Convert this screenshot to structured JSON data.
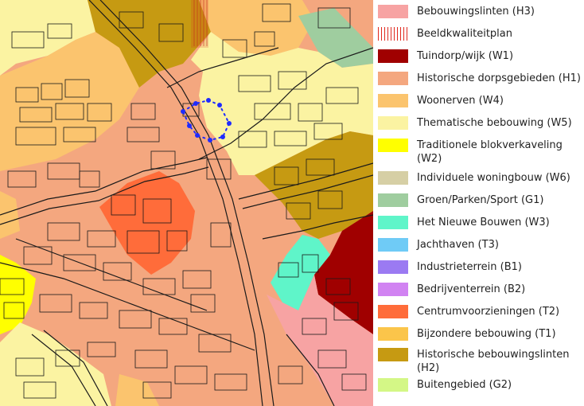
{
  "legend": {
    "items": [
      {
        "label": "Bebouwingslinten (H3)",
        "color": "#f7a3a3",
        "pattern": "solid"
      },
      {
        "label": "Beeldkwaliteitplan",
        "color": "#e0291f",
        "pattern": "hatch"
      },
      {
        "label": "Tuindorp/wijk (W1)",
        "color": "#a00000",
        "pattern": "solid"
      },
      {
        "label": "Historische dorpsgebieden (H1)",
        "color": "#f4a77f",
        "pattern": "solid"
      },
      {
        "label": "Woonerven (W4)",
        "color": "#fbc46e",
        "pattern": "solid"
      },
      {
        "label": "Thematische bebouwing (W5)",
        "color": "#fbf3a2",
        "pattern": "solid"
      },
      {
        "label": "Traditionele blokverkaveling (W2)",
        "color": "#ffff00",
        "pattern": "solid"
      },
      {
        "label": "Individuele woningbouw (W6)",
        "color": "#d6cfa5",
        "pattern": "solid"
      },
      {
        "label": "Groen/Parken/Sport (G1)",
        "color": "#9fcd9f",
        "pattern": "solid"
      },
      {
        "label": "Het Nieuwe Bouwen (W3)",
        "color": "#5ff5c9",
        "pattern": "solid"
      },
      {
        "label": "Jachthaven (T3)",
        "color": "#6fcbf6",
        "pattern": "solid"
      },
      {
        "label": "Industrieterrein (B1)",
        "color": "#9b7af2",
        "pattern": "solid"
      },
      {
        "label": "Bedrijventerrein (B2)",
        "color": "#d183f2",
        "pattern": "solid"
      },
      {
        "label": "Centrumvoorzieningen (T2)",
        "color": "#ff6c3a",
        "pattern": "solid"
      },
      {
        "label": "Bijzondere bebouwing (T1)",
        "color": "#fbc54a",
        "pattern": "solid"
      },
      {
        "label": "Historische bebouwingslinten (H2)",
        "color": "#c69a12",
        "pattern": "solid"
      },
      {
        "label": "Buitengebied (G2)",
        "color": "#d4f786",
        "pattern": "solid"
      }
    ]
  },
  "map": {
    "colors": {
      "background": "#f4a77f",
      "h2": "#c69a12",
      "w4": "#fbc46e",
      "w5": "#fbf3a2",
      "w2": "#ffff00",
      "w1": "#a00000",
      "w3": "#5ff5c9",
      "h3": "#f7a3a3",
      "g1": "#9fcd9f",
      "t2": "#ff6c3a",
      "lines": "#1a1a1a",
      "marker": "#1f2bff"
    }
  }
}
